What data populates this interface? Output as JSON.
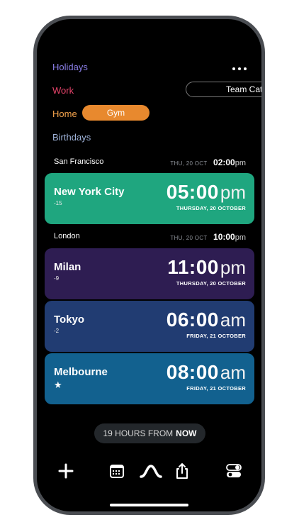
{
  "calendars": {
    "holidays": {
      "label": "Holidays",
      "color": "#8b7fe8"
    },
    "work": {
      "label": "Work",
      "color": "#e8446b"
    },
    "home": {
      "label": "Home",
      "color": "#f4a34c"
    },
    "birthdays": {
      "label": "Birthdays",
      "color": "#9fb3d9"
    }
  },
  "pills": {
    "team": "Team Catc",
    "gym": "Gym"
  },
  "reference_rows": [
    {
      "city": "San Francisco",
      "date": "THU, 20 OCT",
      "time": "02:00",
      "ampm": "pm"
    },
    {
      "city": "London",
      "date": "THU, 20 OCT",
      "time": "10:00",
      "ampm": "pm"
    }
  ],
  "cards": [
    {
      "city": "New York City",
      "offset": "-15",
      "time": "05:00",
      "ampm": "pm",
      "date": "THURSDAY, 20 OCTOBER",
      "color": "#1fa67f"
    },
    {
      "city": "Milan",
      "offset": "-9",
      "time": "11:00",
      "ampm": "pm",
      "date": "THURSDAY, 20 OCTOBER",
      "color": "#2e1d52"
    },
    {
      "city": "Tokyo",
      "offset": "-2",
      "time": "06:00",
      "ampm": "am",
      "date": "FRIDAY, 21 OCTOBER",
      "color": "#213c72"
    },
    {
      "city": "Melbourne",
      "offset": "",
      "time": "08:00",
      "ampm": "am",
      "date": "FRIDAY, 21 OCTOBER",
      "color": "#12618f"
    }
  ],
  "from_now": {
    "prefix": "19 HOURS FROM",
    "emphasis": "NOW"
  },
  "toolbar": [
    "plus-icon",
    "calendar-icon",
    "curve-icon",
    "share-icon",
    "toggles-icon"
  ]
}
